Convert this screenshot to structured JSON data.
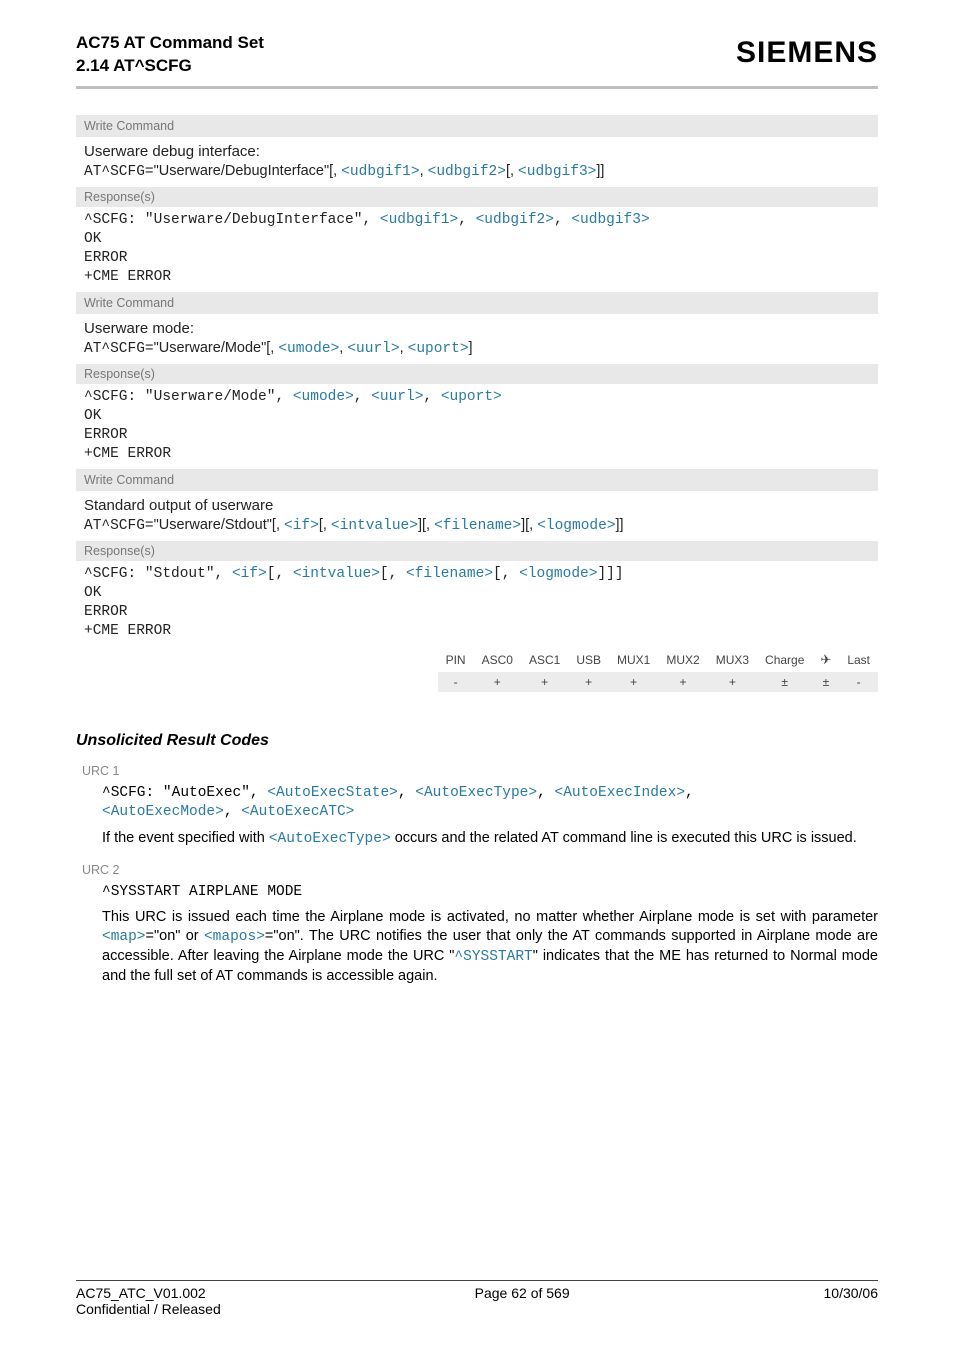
{
  "header": {
    "line1": "AC75 AT Command Set",
    "line2": "2.14 AT^SCFG",
    "brand": "SIEMENS"
  },
  "blocks": [
    {
      "labelWrite": "Write Command",
      "subtitle": "Userware debug interface:",
      "cmd": {
        "pre": "AT^SCFG=",
        "sans1": "\"Userware/DebugInterface\"[",
        "p1": "<udbgif1>",
        "s1": ", ",
        "p2": "<udbgif2>",
        "s2": "[, ",
        "p3": "<udbgif3>",
        "s3": "]]"
      },
      "labelResp": "Response(s)",
      "resp": {
        "pre": "^SCFG: ",
        "sans1": "\"Userware/DebugInterface\",",
        "sp0": " ",
        "p1": "<udbgif1>",
        "s1": ", ",
        "p2": "<udbgif2>",
        "s2": ", ",
        "p3": "<udbgif3>"
      },
      "ok": "OK",
      "err": "ERROR",
      "cme": "+CME ERROR"
    },
    {
      "labelWrite": "Write Command",
      "subtitle": "Userware mode:",
      "cmd": {
        "pre": "AT^SCFG=",
        "sans1": "\"Userware/Mode\"[",
        "s0": ", ",
        "p1": "<umode>",
        "s1": ", ",
        "p2": "<uurl>",
        "s2": ", ",
        "p3": "<uport>",
        "s3": "]"
      },
      "labelResp": "Response(s)",
      "resp": {
        "pre": "^SCFG: ",
        "sans1": "\"Userware/Mode\",",
        "sp0": " ",
        "p1": "<umode>",
        "s1": ", ",
        "p2": "<uurl>",
        "s2": ", ",
        "p3": "<uport>"
      },
      "ok": "OK",
      "err": "ERROR",
      "cme": "+CME ERROR"
    },
    {
      "labelWrite": "Write Command",
      "subtitle": "Standard output of userware",
      "cmd": {
        "pre": "AT^SCFG=",
        "sans1": "\"Userware/Stdout\"[",
        "s0": ", ",
        "p1": "<if>",
        "s1": "[, ",
        "p2": "<intvalue>",
        "s2": "][, ",
        "p3": "<filename>",
        "s3": "][, ",
        "p4": "<logmode>",
        "s4": "]]"
      },
      "labelResp": "Response(s)",
      "resp": {
        "pre": "^SCFG: ",
        "sans1": "\"Stdout\"",
        "sp0": ", ",
        "p1": "<if>",
        "s1": "[, ",
        "p2": "<intvalue>",
        "s2": "[, ",
        "p3": "<filename>",
        "s3": "[, ",
        "p4": "<logmode>",
        "s4": "]]]"
      },
      "ok": "OK",
      "err": "ERROR",
      "cme": "+CME ERROR"
    }
  ],
  "matrix": {
    "cols": [
      "PIN",
      "ASC0",
      "ASC1",
      "USB",
      "MUX1",
      "MUX2",
      "MUX3",
      "Charge",
      "plane",
      "Last"
    ],
    "vals": [
      "-",
      "+",
      "+",
      "+",
      "+",
      "+",
      "+",
      "±",
      "±",
      "-"
    ]
  },
  "urc": {
    "heading": "Unsolicited Result Codes",
    "u1label": "URC 1",
    "u1code_pre": "^SCFG: \"AutoExec\", ",
    "u1p1": "<AutoExecState>",
    "u1s1": ", ",
    "u1p2": "<AutoExecType>",
    "u1s2": ", ",
    "u1p3": "<AutoExecIndex>",
    "u1s3": ", ",
    "u1p4": "<AutoExecMode>",
    "u1s4": ", ",
    "u1p5": "<AutoExecATC>",
    "u1desc_a": "If the event specified with ",
    "u1desc_p": "<AutoExecType>",
    "u1desc_b": " occurs and the related AT command line is executed this URC is issued.",
    "u2label": "URC 2",
    "u2code": "^SYSSTART AIRPLANE MODE",
    "u2desc_a": "This URC is issued each time the Airplane mode is activated, no matter whether Airplane mode is set with parameter ",
    "u2p1": "<map>",
    "u2desc_b": "=\"on\" or ",
    "u2p2": "<mapos>",
    "u2desc_c": "=\"on\". The URC notifies the user that only the AT commands supported in Airplane mode are accessible. After leaving the Airplane mode the URC \"",
    "u2p3": "^SYSSTART",
    "u2desc_d": "\" indicates that the ME has returned to Normal mode and the full set of AT commands is accessible again."
  },
  "footer": {
    "left1": "AC75_ATC_V01.002",
    "left2": "Confidential / Released",
    "center": "Page 62 of 569",
    "right": "10/30/06"
  }
}
